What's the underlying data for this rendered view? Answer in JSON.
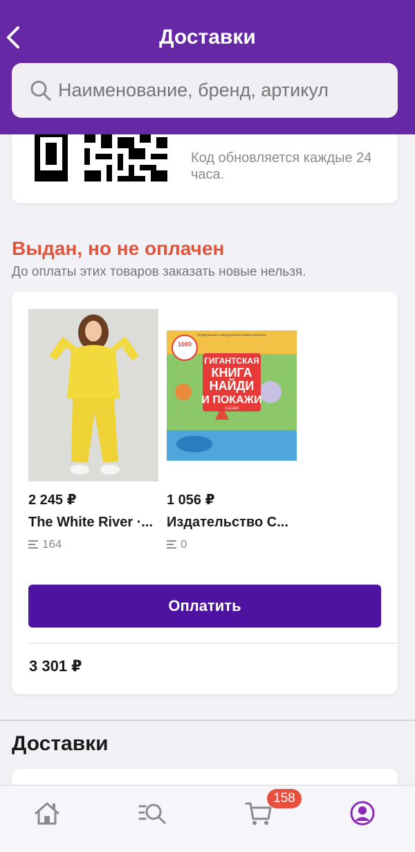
{
  "header": {
    "title": "Доставки"
  },
  "search": {
    "placeholder": "Наименование, бренд, артикул"
  },
  "qr": {
    "code_partial": "· ·",
    "note": "Код обновляется каждые 24 часа."
  },
  "unpaid": {
    "title": "Выдан, но не оплачен",
    "subtitle": "До оплаты этих товаров заказать новые нельзя.",
    "products": [
      {
        "price": "2 245 ₽",
        "name": "The White River ·...",
        "count": "164"
      },
      {
        "price": "1 056 ₽",
        "name": "Издательство С...",
        "count": "0",
        "book_top_text": "ПРОДОЛЬНЫЕ И ЗАГАДОЧНЫЕ КНИЖКИ-ИСКАЛКИ",
        "book_badge": "1000 предметов для поиска + 5 мотивов бродилки",
        "book_title": [
          "ГИГАНТСКАЯ",
          "КНИГА",
          "НАЙДИ",
          "И ПОКАЖИ"
        ],
        "book_publisher": "CLEVER"
      }
    ],
    "pay_label": "Оплатить",
    "total": "3 301 ₽"
  },
  "deliveries_heading": "Доставки",
  "tabbar": {
    "cart_badge": "158"
  },
  "colors": {
    "brand": "#6628a4",
    "button": "#4e13a0",
    "alert": "#e2553c",
    "badge": "#e8503d"
  }
}
